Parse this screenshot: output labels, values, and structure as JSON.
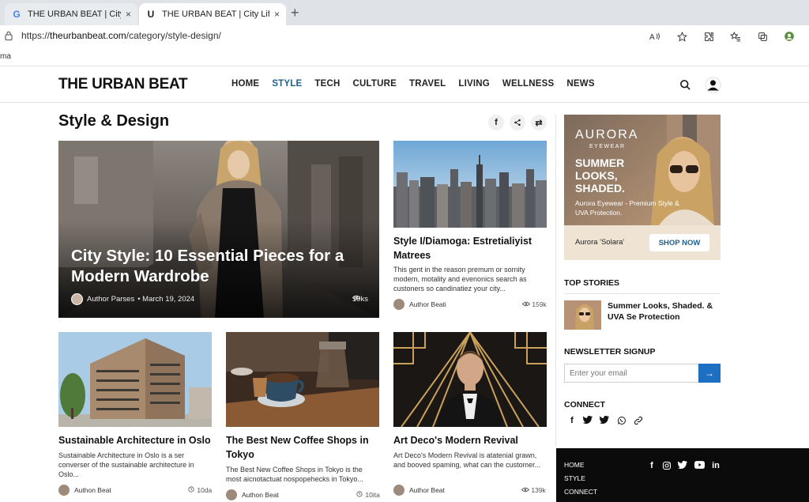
{
  "browser": {
    "tabs": [
      {
        "favicon": "G",
        "title": "THE URBAN BEAT | City Life, S",
        "close": "×"
      },
      {
        "favicon": "U",
        "title": "THE URBAN BEAT | City Life, St",
        "close": "×"
      }
    ],
    "new_tab": "+",
    "url_prefix": "https://",
    "url_host": "theurbanbeat.com",
    "url_path": "/category/style-design/",
    "favorites_bar_item": "ma",
    "toolbar_icons": [
      "read-aloud-icon",
      "favorite-star-icon",
      "extensions-icon",
      "favorites-icon",
      "collections-icon",
      "profile-icon"
    ]
  },
  "site": {
    "logo": "THE URBAN BEAT",
    "nav": [
      "HOME",
      "STYLE",
      "TECH",
      "CULTURE",
      "TRAVEL",
      "LIVING",
      "WELLNESS",
      "NEWS"
    ],
    "active_nav": "STYLE"
  },
  "section": {
    "title": "Style & Design",
    "share_icons": [
      "f",
      "<",
      "⇄"
    ]
  },
  "hero": {
    "title": "City Style: 10 Essential Pieces for a Modern Wardrobe",
    "author": "Author Parses",
    "date": "• March 19, 2024",
    "views": "19ks"
  },
  "cards": [
    {
      "title": "Style I/Diamoga: Estretialiyist Matrees",
      "excerpt": "This gent in the reason premum or sornity modern, motality and evenonics search as custoners so candinatiez your city...",
      "author": "Author Beati",
      "views": "159k"
    },
    {
      "title": "Sustainable Architecture in Oslo",
      "excerpt": "Sustainable Architecture in Oslo is a ser converser of the sustainable architecture in Oslo...",
      "author": "Authon Beat",
      "views": "10da"
    },
    {
      "title": "The Best New Coffee Shops in Tokyo",
      "excerpt": "The Best New Coffee Shops in Tokyo is the most aicnotactuat nospopehecks in Tokyo...",
      "author": "Authon Beat",
      "views": "10ita"
    },
    {
      "title": "Art Deco's Modern Revival",
      "excerpt": "Art Deco's Modern Revival is atatenial grawn, and booved spaming, what can the customer...",
      "author": "Author Beat",
      "views": "139k"
    }
  ],
  "ad": {
    "brand": "AURORA",
    "brand_sub": "EYEWEAR",
    "headline": "SUMMER LOOKS, SHADED.",
    "subtext": "Aurora Eyewear - Premium Style & UVA Protection.",
    "product": "Aurora 'Solara'",
    "cta": "SHOP NOW"
  },
  "sidebar": {
    "top_stories_heading": "TOP STORIES",
    "top_story_title": "Summer Looks, Shaded. & UVA Se Protection",
    "newsletter_heading": "NEWSLETTER SIGNUP",
    "newsletter_placeholder": "Enter your email",
    "newsletter_button": "→",
    "connect_heading": "CONNECT",
    "connect_icons": [
      "f",
      "t",
      "t",
      "w",
      "🔗"
    ]
  },
  "footer": {
    "links": [
      "HOME",
      "STYLE",
      "CONNECT"
    ],
    "social_icons": [
      "f",
      "◎",
      "t",
      "▶",
      "in"
    ]
  },
  "colors": {
    "accent": "#1e5f8c",
    "button_blue": "#1d6fc2",
    "footer_bg": "#0b0b0b"
  }
}
